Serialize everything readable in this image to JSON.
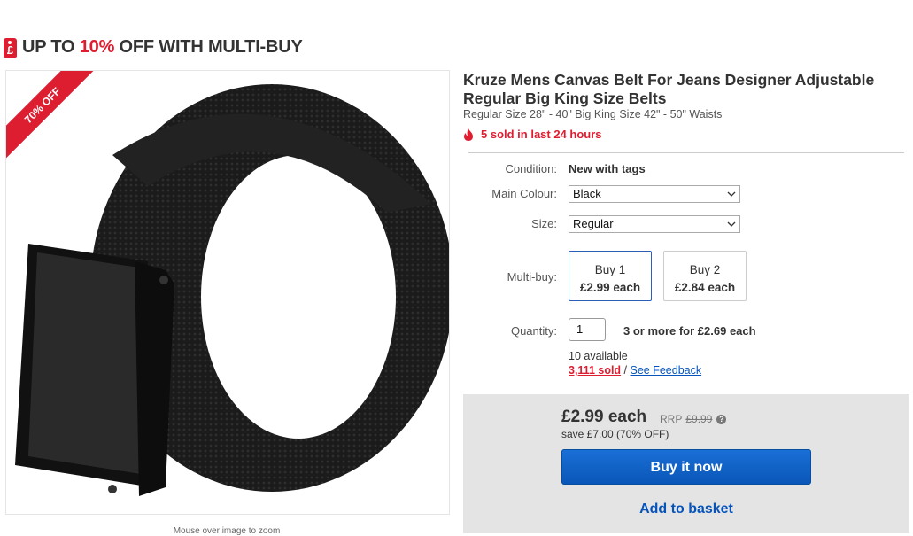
{
  "promo": {
    "prefix": "UP TO ",
    "percent": "10%",
    "suffix": " OFF WITH MULTI-BUY",
    "icon": "price-tag-icon",
    "icon_glyph": "£"
  },
  "image": {
    "ribbon": "70% OFF",
    "zoom_hint": "Mouse over image to zoom"
  },
  "listing": {
    "title": "Kruze Mens Canvas Belt For Jeans Designer Adjustable Regular Big King Size Belts",
    "subtitle": "Regular Size 28\" - 40\" Big King Size 42\" - 50\" Waists",
    "hot_text": "5 sold in last 24 hours"
  },
  "details": {
    "condition_label": "Condition:",
    "condition_value": "New with tags",
    "colour_label": "Main Colour:",
    "colour_value": "Black",
    "size_label": "Size:",
    "size_value": "Regular",
    "multibuy_label": "Multi-buy:",
    "multibuy": [
      {
        "line1": "Buy 1",
        "line2": "£2.99 each",
        "selected": true
      },
      {
        "line1": "Buy 2",
        "line2": "£2.84 each",
        "selected": false
      }
    ],
    "quantity_label": "Quantity:",
    "quantity_value": "1",
    "quantity_offer": "3 or more for £2.69 each",
    "available": "10 available",
    "sold": "3,111 sold",
    "separator": " / ",
    "feedback": "See Feedback"
  },
  "buybox": {
    "price": "£2.99 each",
    "rrp_label": "RRP",
    "rrp_value": "£9.99",
    "save": "save £7.00 (70% OFF)",
    "buy_now": "Buy it now",
    "add_basket": "Add to basket"
  },
  "colors": {
    "accent_red": "#dd1e31",
    "link_blue": "#0654ba",
    "buy_blue": "#0a56b8"
  }
}
